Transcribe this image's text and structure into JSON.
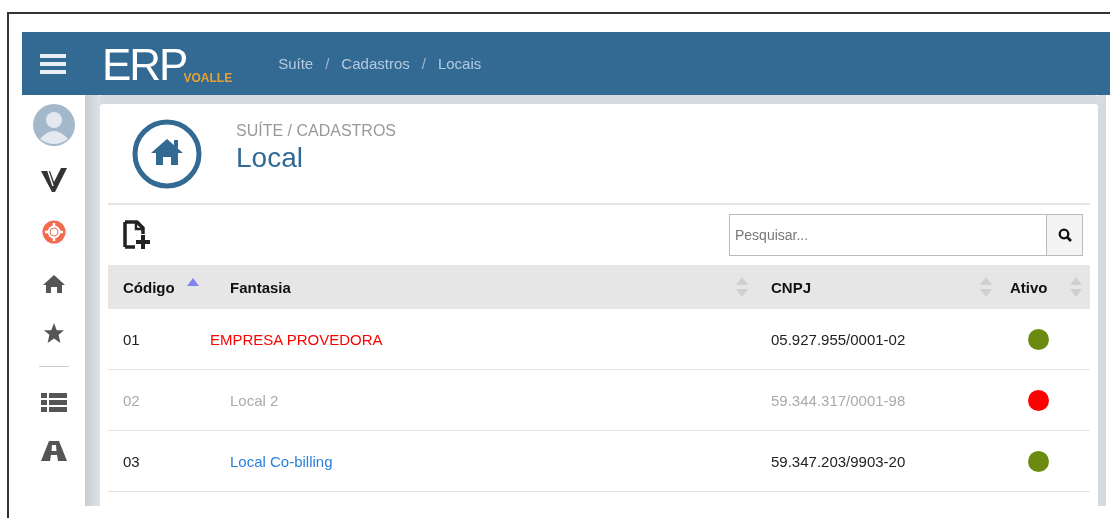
{
  "topbar": {
    "logo": {
      "main": "ERP",
      "sub": "VOALLE"
    },
    "breadcrumb": [
      {
        "text": "Suíte",
        "kind": "link"
      },
      {
        "text": "/",
        "kind": "separator"
      },
      {
        "text": "Cadastros",
        "kind": "link"
      },
      {
        "text": "/",
        "kind": "separator"
      },
      {
        "text": "Locais",
        "kind": "link"
      }
    ]
  },
  "page_header": {
    "breadcrumb": "SUÍTE / CADASTROS",
    "title": "Local"
  },
  "search": {
    "placeholder": "Pesquisar..."
  },
  "table": {
    "columns": [
      {
        "label": "Código",
        "sorted": true
      },
      {
        "label": "Fantasia",
        "sorted": false
      },
      {
        "label": "CNPJ",
        "sorted": false
      },
      {
        "label": "Ativo",
        "sorted": false
      }
    ],
    "rows": [
      {
        "code": "01",
        "name": "EMPRESA PROVEDORA",
        "kind": "emphasis",
        "cnpj": "05.927.955/0001-02",
        "active": true
      },
      {
        "code": "02",
        "name": "Local 2",
        "kind": "plain",
        "cnpj": "59.344.317/0001-98",
        "active": false
      },
      {
        "code": "03",
        "name": "Local Co-billing",
        "kind": "link",
        "cnpj": "59.347.203/9903-20",
        "active": true
      }
    ]
  }
}
